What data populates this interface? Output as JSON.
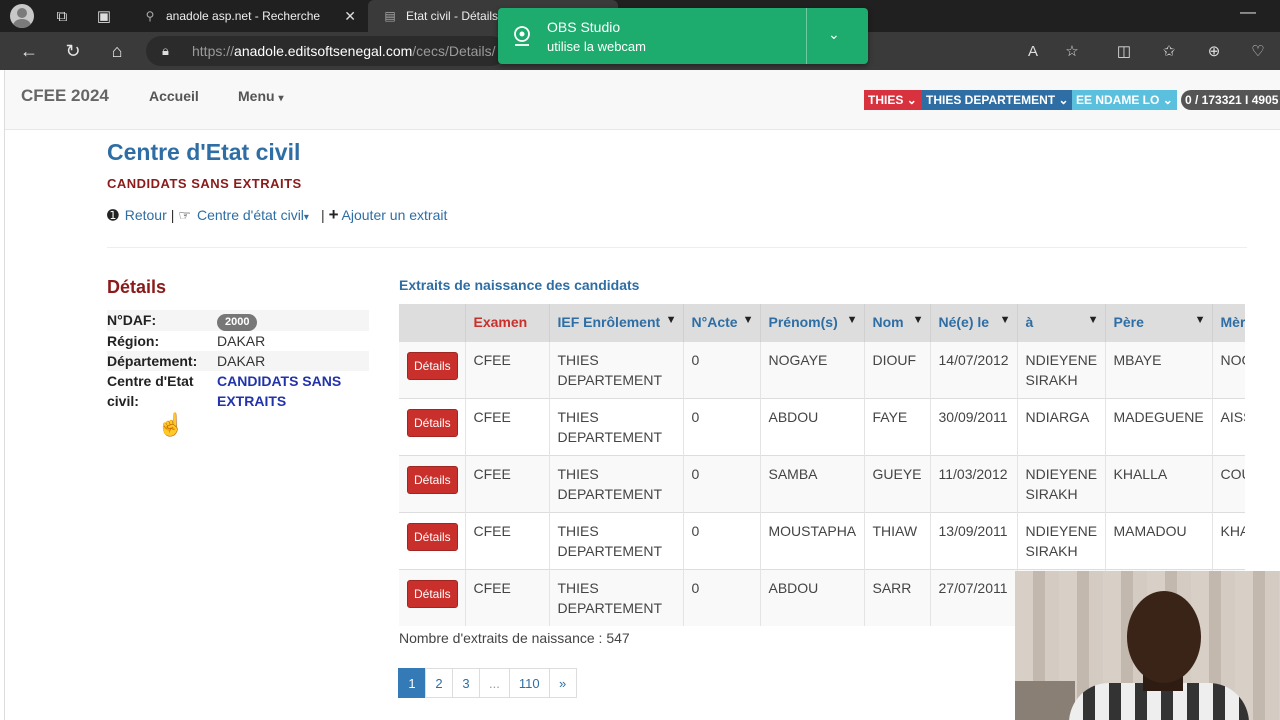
{
  "browser": {
    "tabs": [
      {
        "title": "anadole asp.net - Recherche",
        "icon": "search-icon"
      },
      {
        "title": "Etat civil - Détails",
        "icon": "document-icon"
      }
    ],
    "url_prefix": "https://",
    "url_host": "anadole.editsoftsenegal.com",
    "url_path": "/cecs/Details/"
  },
  "notification": {
    "title": "OBS Studio",
    "message": "utilise la webcam"
  },
  "navbar": {
    "brand": "CFEE 2024",
    "home": "Accueil",
    "menu": "Menu",
    "region": "THIES",
    "departement": "THIES DEPARTEMENT",
    "centre": "EE NDAME LO",
    "count": "0 / 173321 I 4905"
  },
  "page": {
    "title": "Centre d'Etat civil",
    "subtitle": "CANDIDATS SANS EXTRAITS",
    "actions": {
      "back": "Retour",
      "centre": "Centre d'état civil",
      "add": "Ajouter un extrait"
    }
  },
  "details": {
    "title": "Détails",
    "rows": [
      {
        "label": "N°DAF:",
        "value": "2000"
      },
      {
        "label": "Région:",
        "value": "DAKAR"
      },
      {
        "label": "Département:",
        "value": "DAKAR"
      },
      {
        "label": "Centre d'Etat civil:",
        "value": "CANDIDATS SANS EXTRAITS"
      }
    ]
  },
  "extraits": {
    "title": "Extraits de naissance des candidats",
    "columns": [
      "",
      "Examen",
      "IEF Enrôlement",
      "N°Acte",
      "Prénom(s)",
      "Nom",
      "Né(e) le",
      "à",
      "Père",
      "Mère"
    ],
    "button_label": "Détails",
    "rows": [
      {
        "examen": "CFEE",
        "ief": "THIES DEPARTEMENT",
        "acte": "0",
        "prenom": "NOGAYE",
        "nom": "DIOUF",
        "ne_le": "14/07/2012",
        "a": "NDIEYENE SIRAKH",
        "pere": "MBAYE",
        "mere": "NOG"
      },
      {
        "examen": "CFEE",
        "ief": "THIES DEPARTEMENT",
        "acte": "0",
        "prenom": "ABDOU",
        "nom": "FAYE",
        "ne_le": "30/09/2011",
        "a": "NDIARGA",
        "pere": "MADEGUENE",
        "mere": "AISS"
      },
      {
        "examen": "CFEE",
        "ief": "THIES DEPARTEMENT",
        "acte": "0",
        "prenom": "SAMBA",
        "nom": "GUEYE",
        "ne_le": "11/03/2012",
        "a": "NDIEYENE SIRAKH",
        "pere": "KHALLA",
        "mere": "COU"
      },
      {
        "examen": "CFEE",
        "ief": "THIES DEPARTEMENT",
        "acte": "0",
        "prenom": "MOUSTAPHA",
        "nom": "THIAW",
        "ne_le": "13/09/2011",
        "a": "NDIEYENE SIRAKH",
        "pere": "MAMADOU",
        "mere": "KHA"
      },
      {
        "examen": "CFEE",
        "ief": "THIES DEPARTEMENT",
        "acte": "0",
        "prenom": "ABDOU",
        "nom": "SARR",
        "ne_le": "27/07/2011",
        "a": "",
        "pere": "",
        "mere": ""
      }
    ],
    "count_text": "Nombre d'extraits de naissance : 547"
  },
  "pagination": {
    "pages": [
      "1",
      "2",
      "3",
      "...",
      "110",
      "»"
    ],
    "active": "1"
  }
}
